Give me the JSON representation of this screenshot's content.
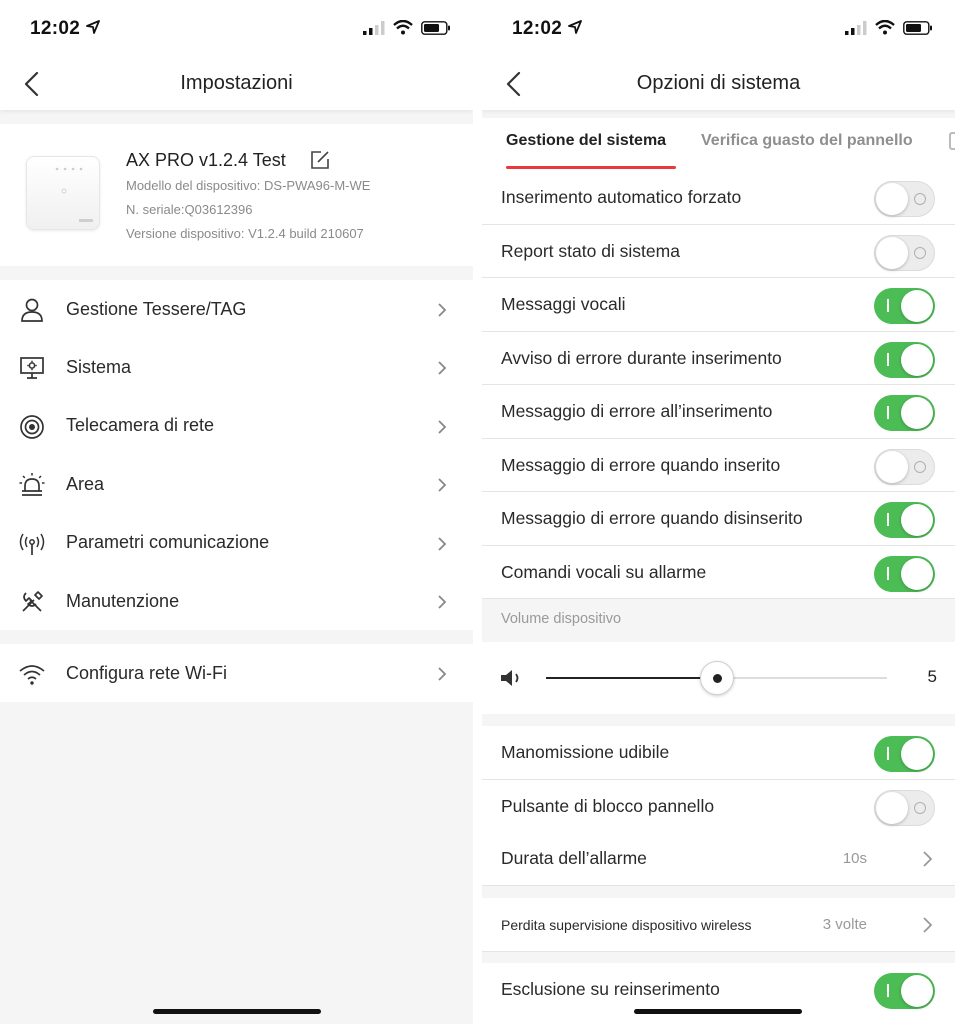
{
  "left": {
    "status": {
      "time": "12:02"
    },
    "nav": {
      "title": "Impostazioni"
    },
    "device": {
      "name": "AX PRO v1.2.4 Test",
      "model": "Modello del dispositivo: DS-PWA96-M-WE",
      "serial": "N. seriale:Q03612396",
      "version": "Versione dispositivo: V1.2.4 build 210607"
    },
    "menu": [
      {
        "label": "Gestione Tessere/TAG",
        "icon": "user-icon"
      },
      {
        "label": "Sistema",
        "icon": "system-monitor-icon"
      },
      {
        "label": "Telecamera di rete",
        "icon": "camera-icon"
      },
      {
        "label": "Area",
        "icon": "alarm-area-icon"
      },
      {
        "label": "Parametri comunicazione",
        "icon": "antenna-icon"
      },
      {
        "label": "Manutenzione",
        "icon": "tools-icon"
      }
    ],
    "menu2": [
      {
        "label": "Configura rete Wi-Fi",
        "icon": "wifi-icon"
      }
    ]
  },
  "right": {
    "status": {
      "time": "12:02"
    },
    "nav": {
      "title": "Opzioni di sistema"
    },
    "tabs": {
      "active": "Gestione del sistema",
      "second": "Verifica guasto del pannello"
    },
    "toggles": [
      {
        "label": "Inserimento automatico forzato",
        "on": false
      },
      {
        "label": "Report stato di sistema",
        "on": false
      },
      {
        "label": "Messaggi vocali",
        "on": true
      },
      {
        "label": "Avviso di errore durante inserimento",
        "on": true
      },
      {
        "label": "Messaggio di errore all’inserimento",
        "on": true
      },
      {
        "label": "Messaggio di errore quando inserito",
        "on": false
      },
      {
        "label": "Messaggio di errore quando disinserito",
        "on": true
      },
      {
        "label": "Comandi vocali su allarme",
        "on": true
      }
    ],
    "volume": {
      "section_label": "Volume dispositivo",
      "value": "5",
      "fraction": 0.5
    },
    "toggles2": [
      {
        "label": "Manomissione udibile",
        "on": true
      },
      {
        "label": "Pulsante di blocco pannello",
        "on": false
      }
    ],
    "alarm_duration": {
      "label": "Durata dell’allarme",
      "value": "10s"
    },
    "supervision": {
      "label": "Perdita supervisione dispositivo wireless",
      "value": "3 volte"
    },
    "bypass": {
      "label": "Esclusione su reinserimento",
      "on": true
    }
  },
  "colors": {
    "toggle_on": "#4cbc55",
    "tab_accent": "#e8393d"
  }
}
